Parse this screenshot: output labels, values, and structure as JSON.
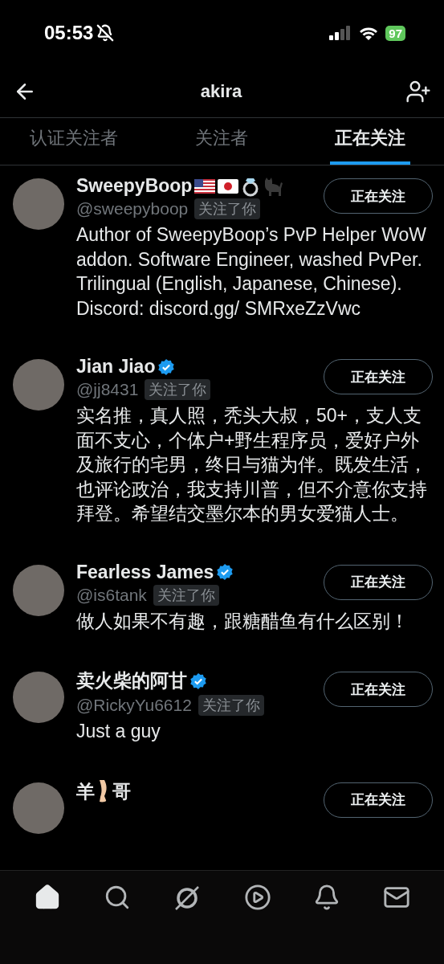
{
  "status_bar": {
    "time": "05:53",
    "silenced": true,
    "battery": "97"
  },
  "header": {
    "title": "akira"
  },
  "tabs": [
    {
      "label": "认证关注者",
      "selected": false
    },
    {
      "label": "关注者",
      "selected": false
    },
    {
      "label": "正在关注",
      "selected": true
    }
  ],
  "users": [
    {
      "name_parts": [
        {
          "kind": "text",
          "text": "SweepyBoop"
        },
        {
          "kind": "flag-us"
        },
        {
          "kind": "flag-jp"
        },
        {
          "kind": "ring"
        },
        {
          "kind": "cat"
        }
      ],
      "verified": false,
      "handle": "@sweepyboop",
      "follows_you": "关注了你",
      "button": "正在关注",
      "bio": "Author of SweepyBoop’s PvP Helper WoW addon. Software Engineer, washed PvPer. Trilingual (English, Japanese, Chinese). Discord: discord.gg/ SMRxeZzVwc"
    },
    {
      "name_parts": [
        {
          "kind": "text",
          "text": "Jian Jiao"
        }
      ],
      "verified": true,
      "handle": "@jj8431",
      "follows_you": "关注了你",
      "button": "正在关注",
      "bio": "实名推，真人照，秃头大叔，50+，支人支面不支心，个体户+野生程序员，爱好户外及旅行的宅男，终日与猫为伴。既发生活，也评论政治，我支持川普，但不介意你支持拜登。希望结交墨尔本的男女爱猫人士。"
    },
    {
      "name_parts": [
        {
          "kind": "text",
          "text": "Fearless James"
        }
      ],
      "verified": true,
      "handle": "@is6tank",
      "follows_you": "关注了你",
      "button": "正在关注",
      "bio": "做人如果不有趣，跟糖醋鱼有什么区别！"
    },
    {
      "name_parts": [
        {
          "kind": "text",
          "text": "卖火柴的阿甘"
        }
      ],
      "verified": true,
      "handle": "@RickyYu6612",
      "follows_you": "关注了你",
      "button": "正在关注",
      "bio": "Just a guy"
    },
    {
      "name_parts": [
        {
          "kind": "text",
          "text": "羊"
        },
        {
          "kind": "leg"
        },
        {
          "kind": "text",
          "text": "哥"
        }
      ],
      "verified": false,
      "button": "正在关注"
    }
  ],
  "bottom_nav": [
    {
      "kind": "home",
      "selected": true
    },
    {
      "kind": "search",
      "selected": false
    },
    {
      "kind": "grok",
      "selected": false
    },
    {
      "kind": "video",
      "selected": false
    },
    {
      "kind": "bell",
      "selected": false
    },
    {
      "kind": "mail",
      "selected": false
    }
  ]
}
